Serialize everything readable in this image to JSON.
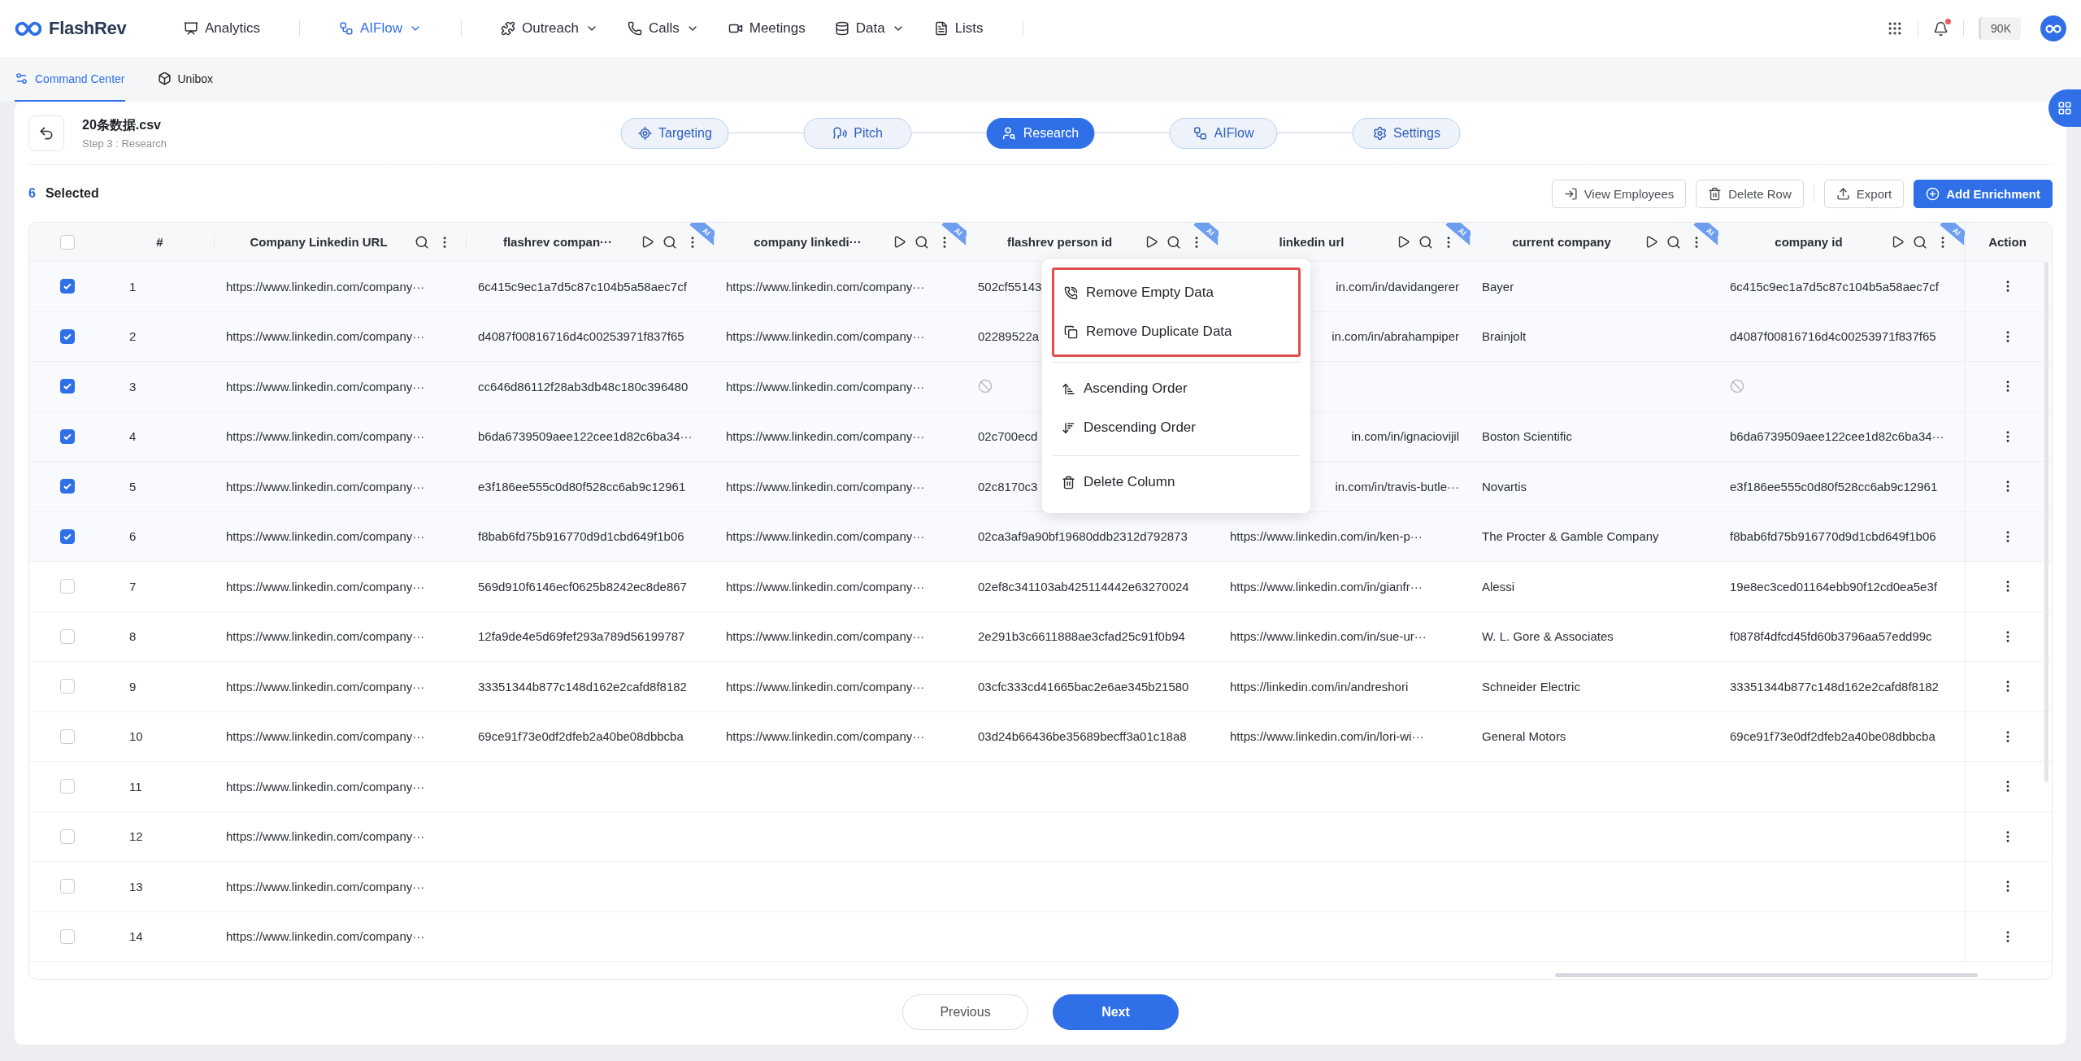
{
  "nav": {
    "logo": "FlashRev",
    "items": [
      {
        "label": "Analytics",
        "selected": false,
        "dropdown": false
      },
      {
        "label": "AIFlow",
        "selected": true,
        "dropdown": true
      },
      {
        "label": "Outreach",
        "selected": false,
        "dropdown": true
      },
      {
        "label": "Calls",
        "selected": false,
        "dropdown": true
      },
      {
        "label": "Meetings",
        "selected": false,
        "dropdown": false
      },
      {
        "label": "Data",
        "selected": false,
        "dropdown": true
      },
      {
        "label": "Lists",
        "selected": false,
        "dropdown": false
      }
    ],
    "credits": "90K",
    "unread": true
  },
  "subnav": [
    {
      "label": "Command Center",
      "selected": true
    },
    {
      "label": "Unibox",
      "selected": false
    }
  ],
  "header": {
    "title": "20条数据.csv",
    "subtitle": "Step 3 : Research"
  },
  "steps": [
    {
      "label": "Targeting",
      "selected": false
    },
    {
      "label": "Pitch",
      "selected": false
    },
    {
      "label": "Research",
      "selected": true
    },
    {
      "label": "AIFlow",
      "selected": false
    },
    {
      "label": "Settings",
      "selected": false
    }
  ],
  "selection": {
    "count": "6",
    "label": "Selected"
  },
  "actions": [
    {
      "label": "View Employees",
      "kind": "outline"
    },
    {
      "label": "Delete Row",
      "kind": "outline"
    },
    {
      "label": "Export",
      "kind": "outline"
    },
    {
      "label": "Add Enrichment",
      "kind": "primary"
    }
  ],
  "table": {
    "all_selected": false,
    "columns": [
      {
        "title": "#",
        "kind": "index"
      },
      {
        "title": "Company Linkedin URL",
        "kind": "data"
      },
      {
        "title": "flashrev compan···",
        "kind": "data",
        "badge": "AI"
      },
      {
        "title": "company linkedi···",
        "kind": "data",
        "badge": "AI"
      },
      {
        "title": "flashrev person id",
        "kind": "data",
        "badge": "AI"
      },
      {
        "title": "linkedin url",
        "kind": "data",
        "badge": "AI"
      },
      {
        "title": "current company",
        "kind": "data",
        "badge": "AI"
      },
      {
        "title": "company id",
        "kind": "data",
        "badge": "AI"
      },
      {
        "title": "Action",
        "kind": "action"
      }
    ],
    "rows": [
      {
        "selected": true,
        "cells": [
          "1",
          "https://www.linkedin.com/company···",
          "6c415c9ec1a7d5c87c104b5a58aec7cf",
          "https://www.linkedin.com/company···",
          "502cf55143",
          {
            "kind": "covered",
            "text": "in.com/in/davidangerer"
          },
          "Bayer",
          "6c415c9ec1a7d5c87c104b5a58aec7cf"
        ]
      },
      {
        "selected": true,
        "cells": [
          "2",
          "https://www.linkedin.com/company···",
          "d4087f00816716d4c00253971f837f65",
          "https://www.linkedin.com/company···",
          "02289522a",
          {
            "kind": "covered",
            "text": "in.com/in/abrahampiper"
          },
          "Brainjolt",
          "d4087f00816716d4c00253971f837f65"
        ]
      },
      {
        "selected": true,
        "cells": [
          "3",
          "https://www.linkedin.com/company···",
          "cc646d86112f28ab3db48c180c396480",
          "https://www.linkedin.com/company···",
          {
            "kind": "empty"
          },
          {
            "kind": "blank"
          },
          {
            "kind": "blank"
          },
          {
            "kind": "empty"
          }
        ]
      },
      {
        "selected": true,
        "cells": [
          "4",
          "https://www.linkedin.com/company···",
          "b6da6739509aee122cee1d82c6ba34···",
          "https://www.linkedin.com/company···",
          "02c700ecd",
          {
            "kind": "covered",
            "text": "in.com/in/ignaciovijil"
          },
          "Boston Scientific",
          "b6da6739509aee122cee1d82c6ba34···"
        ]
      },
      {
        "selected": true,
        "cells": [
          "5",
          "https://www.linkedin.com/company···",
          "e3f186ee555c0d80f528cc6ab9c12961",
          "https://www.linkedin.com/company···",
          "02c8170c3",
          {
            "kind": "covered",
            "text": "in.com/in/travis-butle···"
          },
          "Novartis",
          "e3f186ee555c0d80f528cc6ab9c12961"
        ]
      },
      {
        "selected": true,
        "cells": [
          "6",
          "https://www.linkedin.com/company···",
          "f8bab6fd75b916770d9d1cbd649f1b06",
          "https://www.linkedin.com/company···",
          "02ca3af9a90bf19680ddb2312d792873",
          "https://www.linkedin.com/in/ken-p···",
          "The Procter & Gamble Company",
          "f8bab6fd75b916770d9d1cbd649f1b06"
        ]
      },
      {
        "selected": false,
        "cells": [
          "7",
          "https://www.linkedin.com/company···",
          "569d910f6146ecf0625b8242ec8de867",
          "https://www.linkedin.com/company···",
          "02ef8c341103ab425114442e63270024",
          "https://www.linkedin.com/in/gianfr···",
          "Alessi",
          "19e8ec3ced01164ebb90f12cd0ea5e3f"
        ]
      },
      {
        "selected": false,
        "cells": [
          "8",
          "https://www.linkedin.com/company···",
          "12fa9de4e5d69fef293a789d56199787",
          "https://www.linkedin.com/company···",
          "2e291b3c6611888ae3cfad25c91f0b94",
          "https://www.linkedin.com/in/sue-ur···",
          "W. L. Gore & Associates",
          "f0878f4dfcd45fd60b3796aa57edd99c"
        ]
      },
      {
        "selected": false,
        "cells": [
          "9",
          "https://www.linkedin.com/company···",
          "33351344b877c148d162e2cafd8f8182",
          "https://www.linkedin.com/company···",
          "03cfc333cd41665bac2e6ae345b21580",
          "https://linkedin.com/in/andreshori",
          "Schneider Electric",
          "33351344b877c148d162e2cafd8f8182"
        ]
      },
      {
        "selected": false,
        "cells": [
          "10",
          "https://www.linkedin.com/company···",
          "69ce91f73e0df2dfeb2a40be08dbbcba",
          "https://www.linkedin.com/company···",
          "03d24b66436be35689becff3a01c18a8",
          "https://www.linkedin.com/in/lori-wi···",
          "General Motors",
          "69ce91f73e0df2dfeb2a40be08dbbcba"
        ]
      },
      {
        "selected": false,
        "cells": [
          "11",
          "https://www.linkedin.com/company···"
        ]
      },
      {
        "selected": false,
        "cells": [
          "12",
          "https://www.linkedin.com/company···"
        ]
      },
      {
        "selected": false,
        "cells": [
          "13",
          "https://www.linkedin.com/company···"
        ]
      },
      {
        "selected": false,
        "cells": [
          "14",
          "https://www.linkedin.com/company···"
        ]
      }
    ]
  },
  "column_menu": {
    "groups": [
      {
        "highlighted": true,
        "items": [
          "Remove Empty Data",
          "Remove Duplicate Data"
        ]
      },
      {
        "highlighted": false,
        "items": [
          "Ascending Order",
          "Descending Order"
        ]
      },
      {
        "highlighted": false,
        "items": [
          "Delete Column"
        ]
      }
    ]
  },
  "pagination": [
    {
      "label": "Previous",
      "kind": "outline"
    },
    {
      "label": "Next",
      "kind": "primary"
    }
  ]
}
